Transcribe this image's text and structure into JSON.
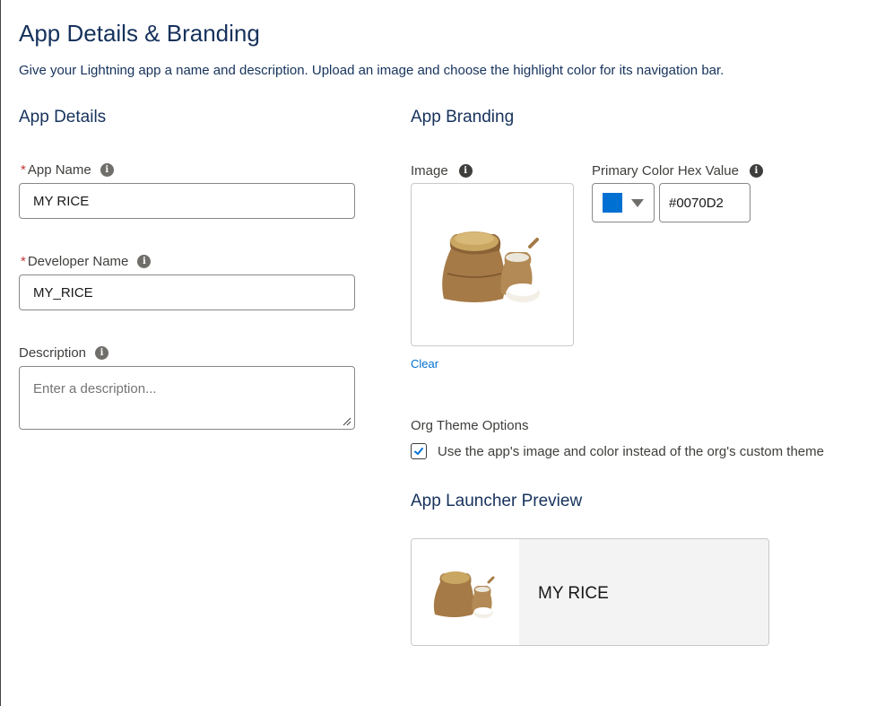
{
  "page": {
    "title": "App Details & Branding",
    "description": "Give your Lightning app a name and description. Upload an image and choose the highlight color for its navigation bar."
  },
  "app_details": {
    "section_title": "App Details",
    "app_name": {
      "label": "App Name",
      "required": "*",
      "value": "MY RICE",
      "info_icon": "info-icon"
    },
    "developer_name": {
      "label": "Developer Name",
      "required": "*",
      "value": "MY_RICE",
      "info_icon": "info-icon"
    },
    "description": {
      "label": "Description",
      "placeholder": "Enter a description...",
      "value": "",
      "info_icon": "info-icon"
    }
  },
  "app_branding": {
    "section_title": "App Branding",
    "image": {
      "label": "Image",
      "clear_label": "Clear",
      "info_icon": "info-icon"
    },
    "primary_color": {
      "label": "Primary Color Hex Value",
      "value": "#0070D2",
      "swatch_color": "#0070d2",
      "info_icon": "info-icon"
    }
  },
  "org_theme": {
    "label": "Org Theme Options",
    "checkbox_label": "Use the app's image and color instead of the org's custom theme",
    "checked": true
  },
  "launcher_preview": {
    "section_title": "App Launcher Preview",
    "app_name": "MY RICE"
  },
  "colors": {
    "accent": "#0070d2",
    "heading": "#16325c",
    "required": "#c23934"
  }
}
